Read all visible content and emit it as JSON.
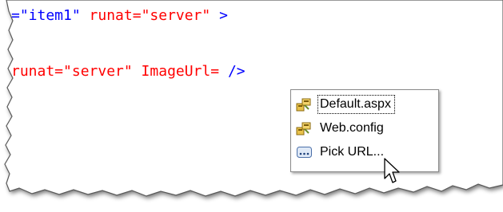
{
  "editor": {
    "line1": {
      "attr": "=\"item1\" ",
      "runat_attr": "runat=\"server\"",
      "close": " >"
    },
    "line2": {
      "runat_attr": "runat=\"server\"",
      "image_attr": " ImageUrl= ",
      "close": "/>"
    }
  },
  "intellisense": {
    "items": [
      {
        "label": "Default.aspx",
        "icon": "project-file-icon",
        "selected": true
      },
      {
        "label": "Web.config",
        "icon": "project-file-icon",
        "selected": false
      },
      {
        "label": "Pick URL...",
        "icon": "ellipsis-icon",
        "selected": false
      }
    ]
  },
  "colors": {
    "attribute_value": "#0000ff",
    "attribute_name": "#ff0000",
    "popup_border": "#8a8a8a"
  }
}
